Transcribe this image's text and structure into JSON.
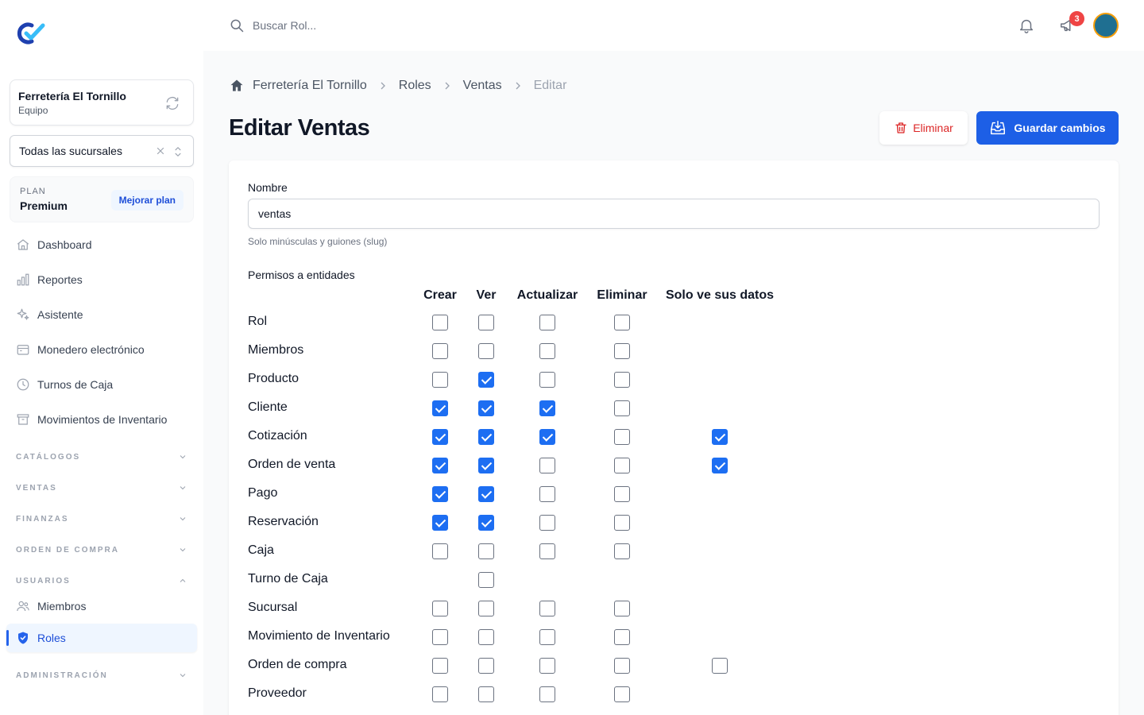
{
  "sidebar": {
    "team_name": "Ferretería El Tornillo",
    "team_sub": "Equipo",
    "branch_value": "Todas las sucursales",
    "plan_label": "PLAN",
    "plan_name": "Premium",
    "upgrade_label": "Mejorar plan",
    "items": [
      {
        "label": "Dashboard",
        "icon": "home-icon"
      },
      {
        "label": "Reportes",
        "icon": "bar-chart-icon"
      },
      {
        "label": "Asistente",
        "icon": "sparkles-icon"
      },
      {
        "label": "Monedero electrónico",
        "icon": "wallet-icon"
      },
      {
        "label": "Turnos de Caja",
        "icon": "clock-icon"
      },
      {
        "label": "Movimientos de Inventario",
        "icon": "archive-icon"
      }
    ],
    "sections": [
      "CATÁLOGOS",
      "VENTAS",
      "FINANZAS",
      "ORDEN DE COMPRA",
      "USUARIOS",
      "ADMINISTRACIÓN"
    ],
    "users_items": [
      {
        "label": "Miembros",
        "icon": "users-icon"
      },
      {
        "label": "Roles",
        "icon": "shield-check-icon"
      }
    ]
  },
  "topbar": {
    "search_placeholder": "Buscar Rol...",
    "notification_count": "3"
  },
  "breadcrumb": [
    "Ferretería El Tornillo",
    "Roles",
    "Ventas",
    "Editar"
  ],
  "page": {
    "title": "Editar Ventas",
    "delete_label": "Eliminar",
    "save_label": "Guardar cambios"
  },
  "form": {
    "name_label": "Nombre",
    "name_value": "ventas",
    "name_help": "Solo minúsculas y guiones (slug)",
    "permissions_label": "Permisos a entidades",
    "columns": [
      "Crear",
      "Ver",
      "Actualizar",
      "Eliminar",
      "Solo ve sus datos"
    ],
    "rows": [
      {
        "name": "Rol",
        "perms": [
          false,
          false,
          false,
          false,
          null
        ]
      },
      {
        "name": "Miembros",
        "perms": [
          false,
          false,
          false,
          false,
          null
        ]
      },
      {
        "name": "Producto",
        "perms": [
          false,
          true,
          false,
          false,
          null
        ]
      },
      {
        "name": "Cliente",
        "perms": [
          true,
          true,
          true,
          false,
          null
        ]
      },
      {
        "name": "Cotización",
        "perms": [
          true,
          true,
          true,
          false,
          true
        ]
      },
      {
        "name": "Orden de venta",
        "perms": [
          true,
          true,
          false,
          false,
          true
        ]
      },
      {
        "name": "Pago",
        "perms": [
          true,
          true,
          false,
          false,
          null
        ]
      },
      {
        "name": "Reservación",
        "perms": [
          true,
          true,
          false,
          false,
          null
        ]
      },
      {
        "name": "Caja",
        "perms": [
          false,
          false,
          false,
          false,
          null
        ]
      },
      {
        "name": "Turno de Caja",
        "perms": [
          null,
          false,
          null,
          null,
          null
        ]
      },
      {
        "name": "Sucursal",
        "perms": [
          false,
          false,
          false,
          false,
          null
        ]
      },
      {
        "name": "Movimiento de Inventario",
        "perms": [
          false,
          false,
          false,
          false,
          null
        ]
      },
      {
        "name": "Orden de compra",
        "perms": [
          false,
          false,
          false,
          false,
          false
        ]
      },
      {
        "name": "Proveedor",
        "perms": [
          false,
          false,
          false,
          false,
          null
        ]
      }
    ]
  },
  "colors": {
    "primary": "#1d5fe6",
    "danger": "#dc2626",
    "checkbox": "#1d6ef2"
  }
}
